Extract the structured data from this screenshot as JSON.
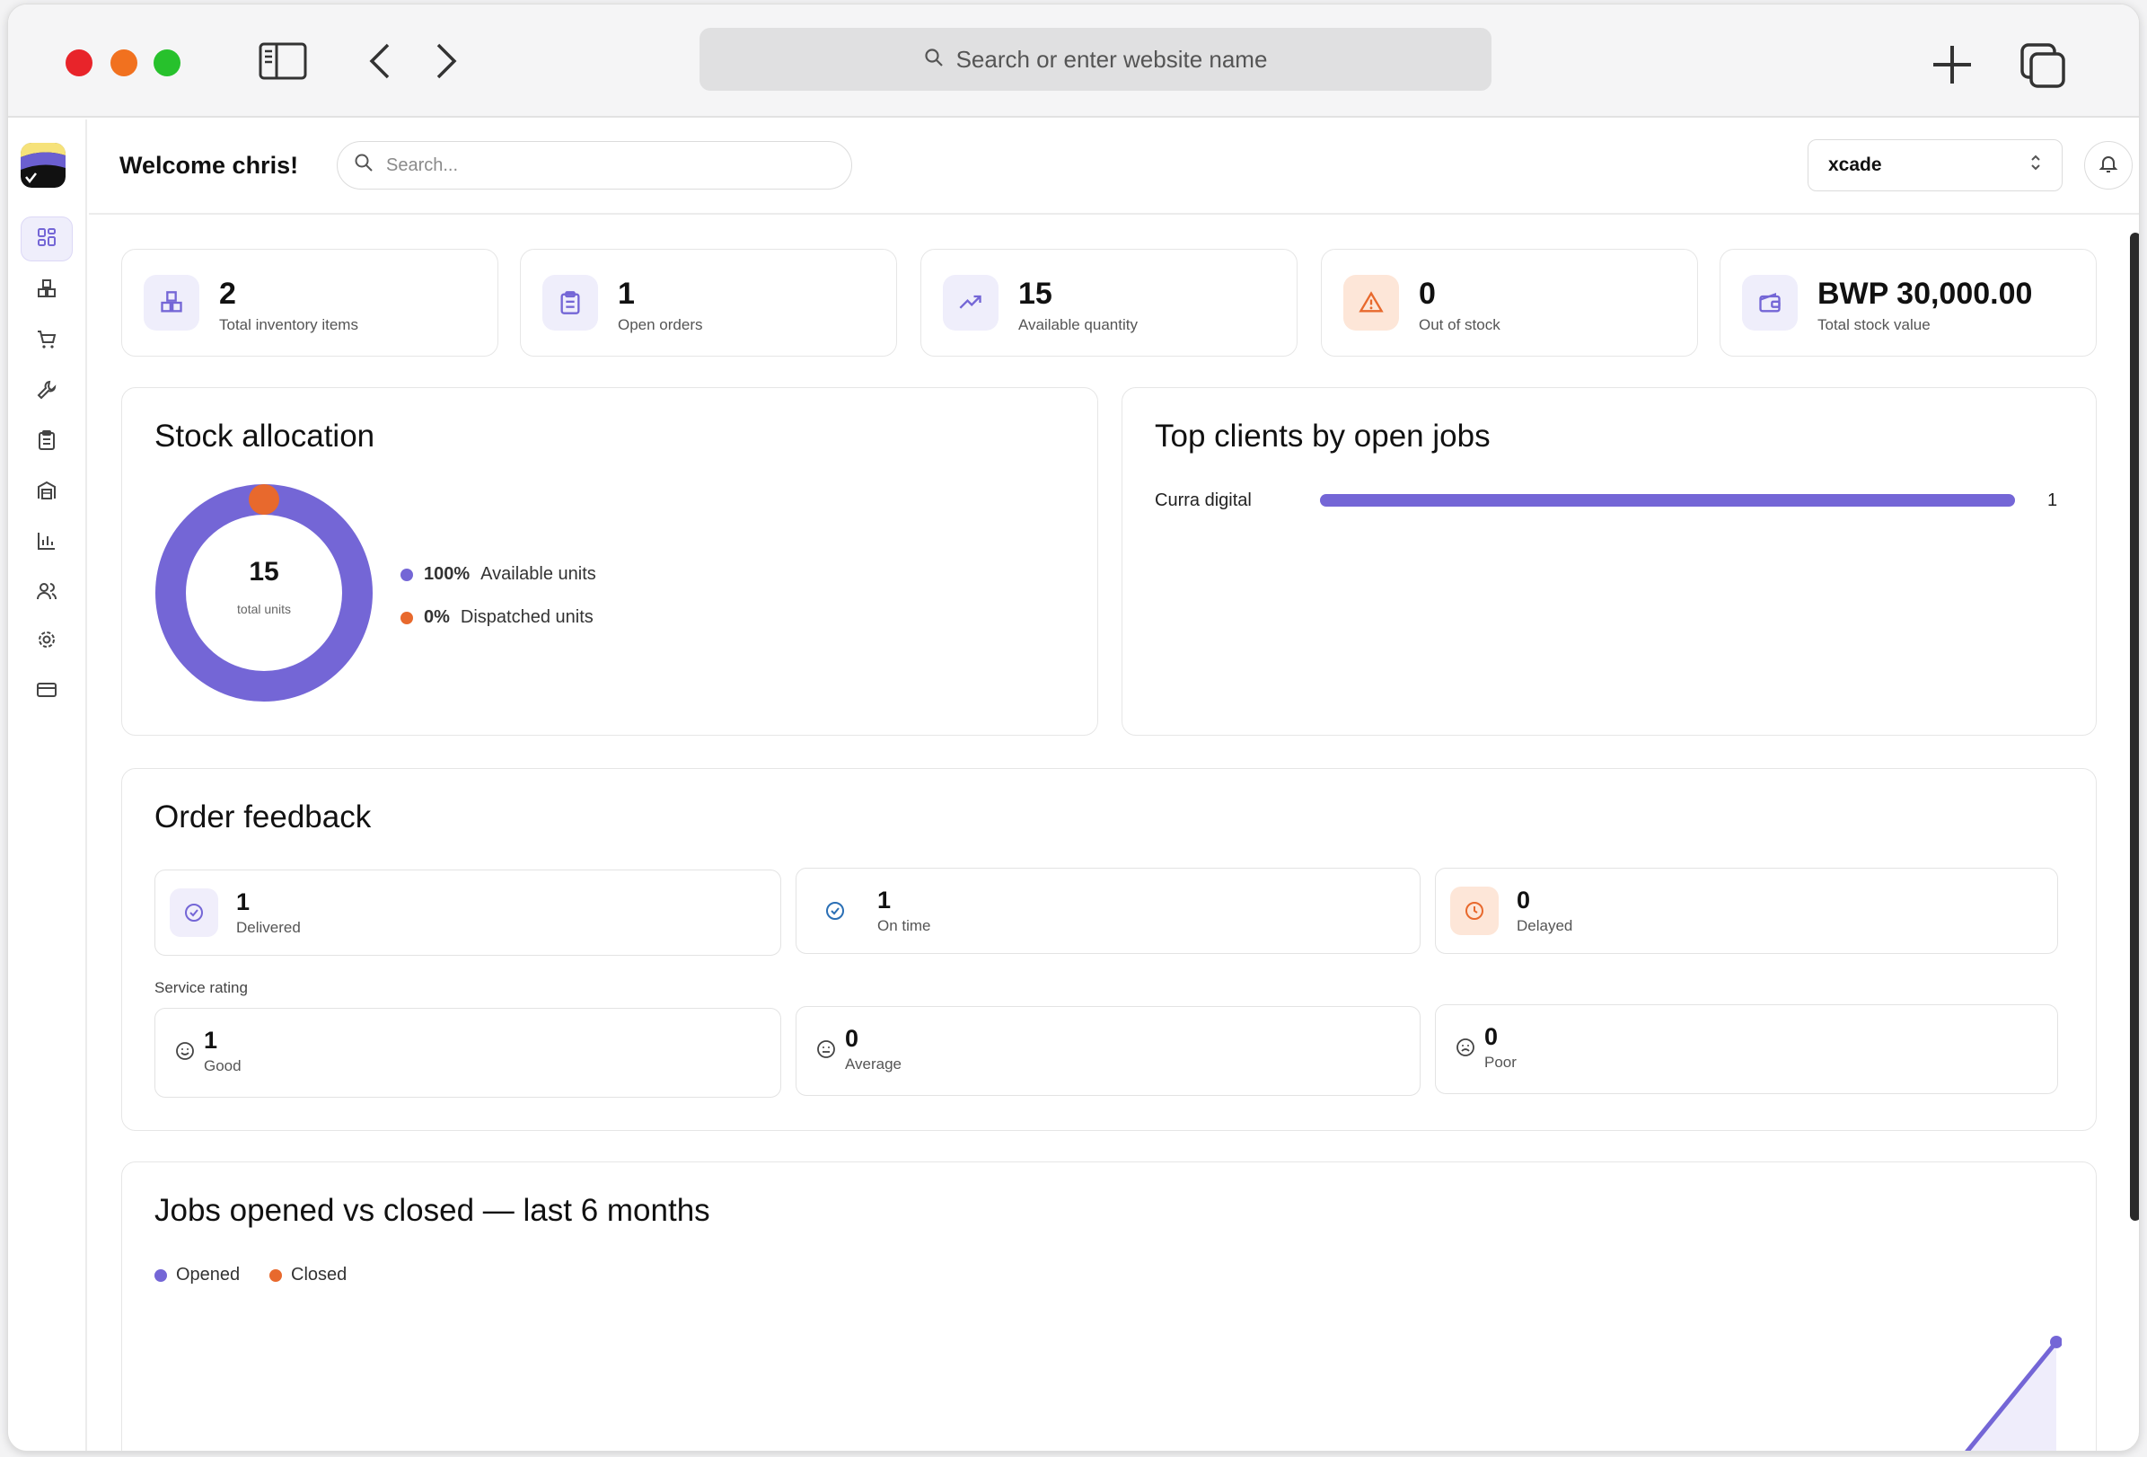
{
  "browser": {
    "search_placeholder": "Search or enter website name"
  },
  "header": {
    "welcome": "Welcome chris!",
    "search_placeholder": "Search...",
    "org_selected": "xcade"
  },
  "sidebar": {
    "items": [
      {
        "icon": "dashboard-icon",
        "active": true
      },
      {
        "icon": "inventory-icon",
        "active": false
      },
      {
        "icon": "cart-icon",
        "active": false
      },
      {
        "icon": "wrench-icon",
        "active": false
      },
      {
        "icon": "clipboard-icon",
        "active": false
      },
      {
        "icon": "building-icon",
        "active": false
      },
      {
        "icon": "bar-chart-icon",
        "active": false
      },
      {
        "icon": "users-icon",
        "active": false
      },
      {
        "icon": "settings-icon",
        "active": false
      },
      {
        "icon": "credit-card-icon",
        "active": false
      }
    ]
  },
  "stats": [
    {
      "value": "2",
      "label": "Total inventory items",
      "icon": "boxes-icon",
      "color": "#7466d6"
    },
    {
      "value": "1",
      "label": "Open orders",
      "icon": "clipboard-icon",
      "color": "#7466d6"
    },
    {
      "value": "15",
      "label": "Available quantity",
      "icon": "trend-up-icon",
      "color": "#7466d6"
    },
    {
      "value": "0",
      "label": "Out of stock",
      "icon": "warning-icon",
      "color": "#e8692d"
    },
    {
      "value": "BWP 30,000.00",
      "label": "Total stock value",
      "icon": "wallet-icon",
      "color": "#7466d6"
    }
  ],
  "stock_allocation": {
    "title": "Stock allocation",
    "total": "15",
    "total_label": "total units",
    "legend": [
      {
        "pct": "100%",
        "label": "Available units",
        "color": "#7466d6"
      },
      {
        "pct": "0%",
        "label": "Dispatched units",
        "color": "#e8692d"
      }
    ]
  },
  "top_clients": {
    "title": "Top clients by open jobs",
    "rows": [
      {
        "name": "Curra digital",
        "value": "1",
        "fraction": 1.0
      }
    ]
  },
  "order_feedback": {
    "title": "Order feedback",
    "status": [
      {
        "value": "1",
        "label": "Delivered",
        "icon": "check-circle-icon"
      },
      {
        "value": "1",
        "label": "On time",
        "icon": "check-circle-icon"
      },
      {
        "value": "0",
        "label": "Delayed",
        "icon": "clock-icon"
      }
    ],
    "service_rating_label": "Service rating",
    "ratings": [
      {
        "value": "1",
        "label": "Good",
        "icon": "smile-icon"
      },
      {
        "value": "0",
        "label": "Average",
        "icon": "neutral-face-icon"
      },
      {
        "value": "0",
        "label": "Poor",
        "icon": "frown-icon"
      }
    ]
  },
  "jobs_chart": {
    "title": "Jobs opened vs closed — last 6 months",
    "legend": [
      {
        "label": "Opened",
        "color": "#7466d6"
      },
      {
        "label": "Closed",
        "color": "#e8692d"
      }
    ]
  },
  "colors": {
    "accent": "#7466d6",
    "orange": "#e8692d"
  }
}
